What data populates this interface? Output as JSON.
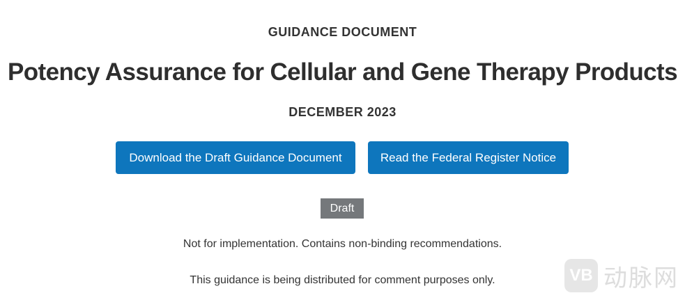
{
  "header": {
    "kicker": "GUIDANCE DOCUMENT",
    "title": "Potency Assurance for Cellular and Gene Therapy Products",
    "date": "DECEMBER 2023"
  },
  "actions": {
    "download_label": "Download the Draft Guidance Document",
    "notice_label": "Read the Federal Register Notice"
  },
  "status": {
    "badge": "Draft",
    "note_1": "Not for implementation. Contains non-binding recommendations.",
    "note_2": "This guidance is being distributed for comment purposes only."
  },
  "watermark": {
    "logo_text": "VB",
    "brand_text": "动脉网"
  },
  "colors": {
    "button": "#0e76bd",
    "badge": "#75787b"
  }
}
